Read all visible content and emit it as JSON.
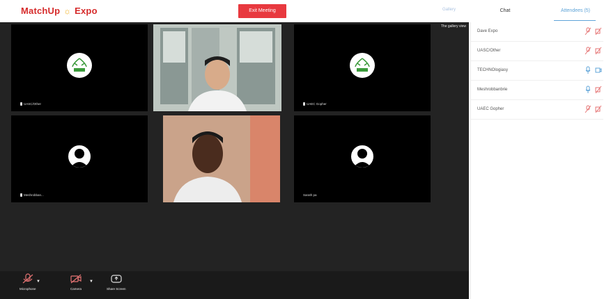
{
  "header": {
    "logo_left": "MatchUp",
    "logo_sun": "☼",
    "logo_right": "Expo",
    "exit_button": "Exit Meeting",
    "gallery_toggle": "Gallery",
    "tabs": {
      "chat": "Chat",
      "participants": "Attendees (5)"
    }
  },
  "stage": {
    "view_label": "The gallery view",
    "tiles": [
      {
        "name": "UASC/Other",
        "kind": "logo",
        "logo_text": "UAECO\nCAM"
      },
      {
        "name": "",
        "kind": "video"
      },
      {
        "name": "UAEC Gopher",
        "kind": "logo",
        "logo_text": "UAECO\nCAM"
      },
      {
        "name": "Meshrobban...",
        "kind": "avatar"
      },
      {
        "name": "",
        "kind": "video2"
      },
      {
        "name": "Sarath pa",
        "kind": "avatar"
      }
    ]
  },
  "toolbar": {
    "microphone": "Microphone",
    "camera": "Camera",
    "share_screen": "Share Screen"
  },
  "participants": [
    {
      "name": "Dave Expo",
      "mic": "muted",
      "cam": "off"
    },
    {
      "name": "UASC/Other",
      "mic": "muted",
      "cam": "off"
    },
    {
      "name": "TECHNOlogiasy",
      "mic": "on",
      "cam": "on"
    },
    {
      "name": "Meshrobbanbrie",
      "mic": "on",
      "cam": "off"
    },
    {
      "name": "UAEC Gopher",
      "mic": "muted",
      "cam": "off"
    }
  ],
  "colors": {
    "brand_red": "#e8393f",
    "accent_blue": "#5fa4d8",
    "muted_red": "#e57373"
  }
}
